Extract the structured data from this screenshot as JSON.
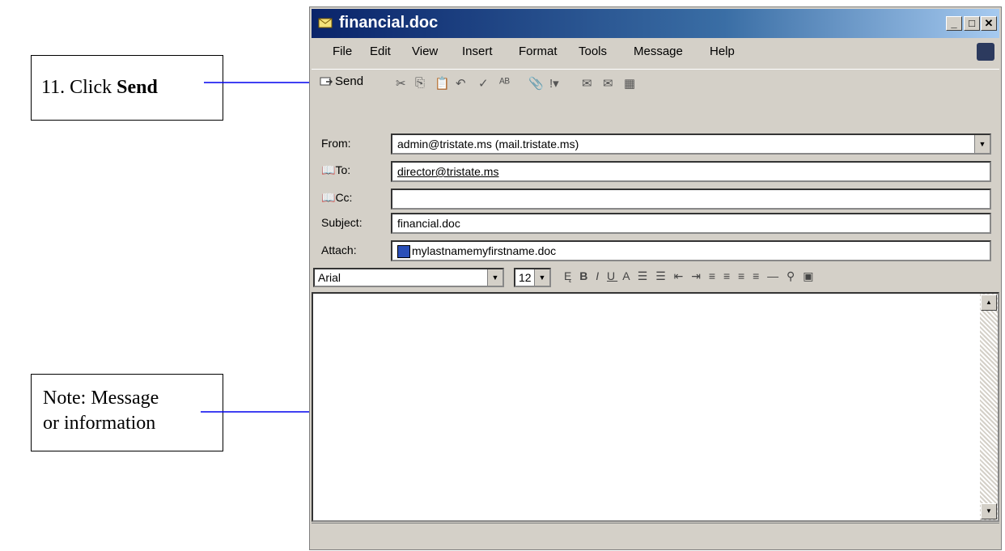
{
  "callouts": {
    "send": {
      "prefix": "11. Click ",
      "bold": "Send"
    },
    "note": {
      "line1": "Note: Message",
      "line2": "or information"
    }
  },
  "window": {
    "title": "financial.doc",
    "controls": {
      "minimize": "_",
      "maximize": "□",
      "close": "✕"
    }
  },
  "menu": [
    "File",
    "Edit",
    "View",
    "Insert",
    "Format",
    "Tools",
    "Message",
    "Help"
  ],
  "toolbar": {
    "send_label": "Send",
    "tools": [
      "cut-icon",
      "copy-icon",
      "paste-icon",
      "undo-icon",
      "check-names-icon",
      "spelling-icon",
      "attach-icon",
      "priority-icon",
      "sign-icon",
      "encrypt-icon",
      "offline-icon"
    ]
  },
  "headers": {
    "from_label": "From:",
    "from_value": "admin@tristate.ms    (mail.tristate.ms)",
    "to_label": "To:",
    "to_value": "director@tristate.ms",
    "cc_label": "Cc:",
    "cc_value": "",
    "subject_label": "Subject:",
    "subject_value": "financial.doc",
    "attach_label": "Attach:",
    "attach_value": "mylastnamemyfirstname.doc"
  },
  "format": {
    "font": "Arial",
    "size": "12"
  },
  "body": {
    "text": ""
  }
}
